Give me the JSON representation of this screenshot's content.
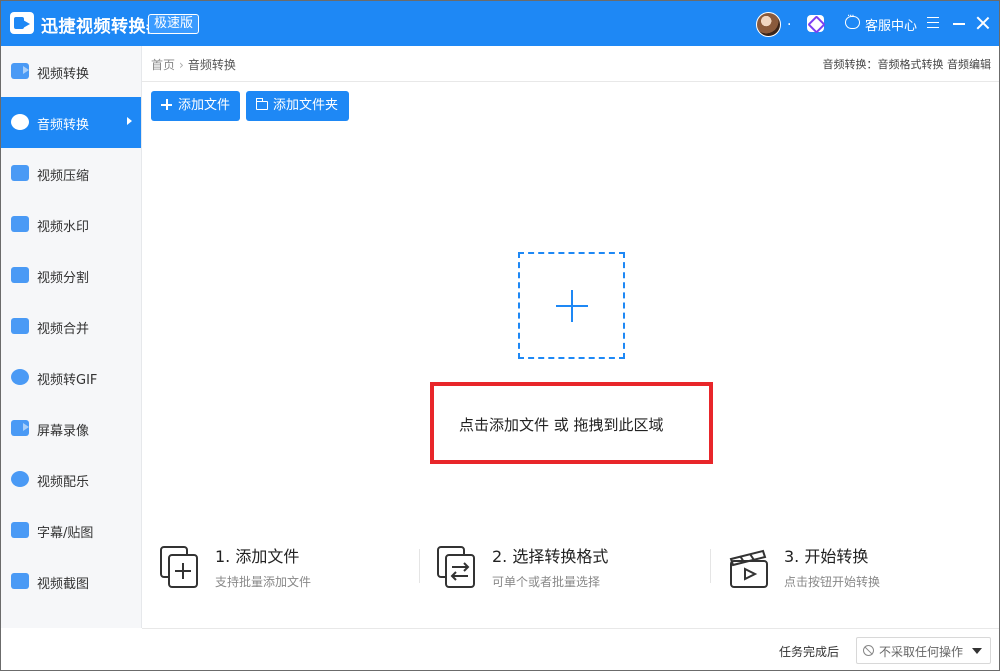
{
  "app": {
    "title": "迅捷视频转换器",
    "badge": "极速版",
    "user_dot": ".",
    "service_label": "客服中心"
  },
  "colors": {
    "accent": "#1e88f5",
    "highlight": "#e8262a"
  },
  "sidebar": {
    "items": [
      {
        "label": "视频转换",
        "icon": "video-convert-icon"
      },
      {
        "label": "音频转换",
        "icon": "audio-convert-icon",
        "active": true
      },
      {
        "label": "视频压缩",
        "icon": "video-compress-icon"
      },
      {
        "label": "视频水印",
        "icon": "video-watermark-icon"
      },
      {
        "label": "视频分割",
        "icon": "video-split-icon"
      },
      {
        "label": "视频合并",
        "icon": "video-merge-icon"
      },
      {
        "label": "视频转GIF",
        "icon": "video-gif-icon"
      },
      {
        "label": "屏幕录像",
        "icon": "screen-record-icon"
      },
      {
        "label": "视频配乐",
        "icon": "video-music-icon"
      },
      {
        "label": "字幕/贴图",
        "icon": "subtitle-icon"
      },
      {
        "label": "视频截图",
        "icon": "screenshot-icon"
      }
    ]
  },
  "breadcrumb": {
    "home": "首页",
    "sep": "›",
    "current": "音频转换"
  },
  "top_links": "音频转换：音频格式转换 音频编辑",
  "toolbar": {
    "add_file": "添加文件",
    "add_folder": "添加文件夹"
  },
  "drop_hint": "点击添加文件 或 拖拽到此区域",
  "steps": [
    {
      "title": "1. 添加文件",
      "desc": "支持批量添加文件",
      "icon": "add-file-icon"
    },
    {
      "title": "2. 选择转换格式",
      "desc": "可单个或者批量选择",
      "icon": "select-format-icon"
    },
    {
      "title": "3. 开始转换",
      "desc": "点击按钮开始转换",
      "icon": "start-convert-icon"
    }
  ],
  "footer": {
    "after_label": "任务完成后",
    "after_value": "不采取任何操作"
  }
}
